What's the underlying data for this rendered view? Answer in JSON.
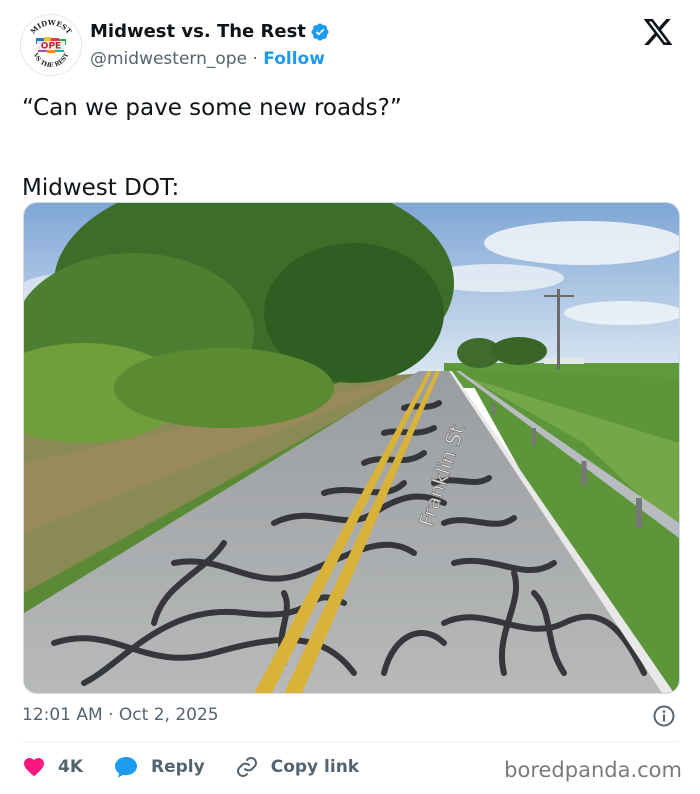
{
  "author": {
    "display_name": "Midwest vs. The Rest",
    "handle": "@midwestern_ope",
    "separator": "·",
    "follow_label": "Follow",
    "avatar_text": {
      "top": "MIDWEST",
      "center": "OPE",
      "bottom": "VS THE REST"
    },
    "verified": true
  },
  "tweet": {
    "text": "“Can we pave some new roads?”\n\nMidwest DOT:",
    "image": {
      "road_sign_text": "Franklin St"
    }
  },
  "meta": {
    "time": "12:01 AM",
    "separator": "·",
    "date": "Oct 2, 2025"
  },
  "actions": {
    "like_count": "4K",
    "reply_label": "Reply",
    "copy_link_label": "Copy link"
  },
  "watermark": "boredpanda.com",
  "colors": {
    "accent": "#1d9bf0",
    "like": "#f91880",
    "text": "#0f1419",
    "muted": "#536471"
  },
  "icons": [
    "x-logo-icon",
    "verified-badge-icon",
    "info-icon",
    "heart-icon",
    "reply-bubble-icon",
    "link-icon"
  ]
}
